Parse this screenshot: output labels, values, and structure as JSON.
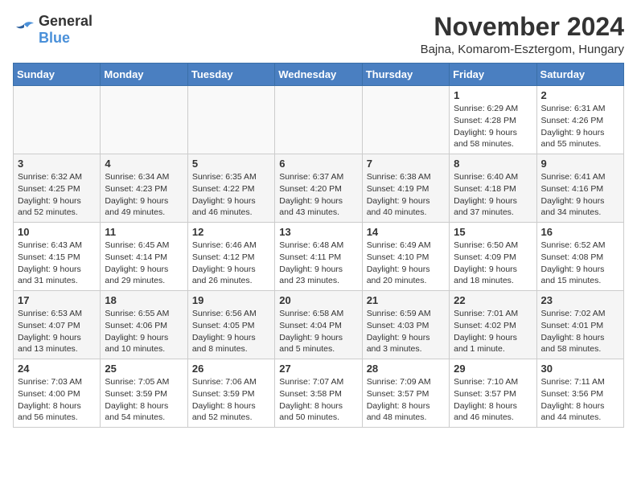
{
  "logo": {
    "general": "General",
    "blue": "Blue"
  },
  "title": "November 2024",
  "location": "Bajna, Komarom-Esztergom, Hungary",
  "days_of_week": [
    "Sunday",
    "Monday",
    "Tuesday",
    "Wednesday",
    "Thursday",
    "Friday",
    "Saturday"
  ],
  "weeks": [
    [
      {
        "day": "",
        "info": ""
      },
      {
        "day": "",
        "info": ""
      },
      {
        "day": "",
        "info": ""
      },
      {
        "day": "",
        "info": ""
      },
      {
        "day": "",
        "info": ""
      },
      {
        "day": "1",
        "info": "Sunrise: 6:29 AM\nSunset: 4:28 PM\nDaylight: 9 hours and 58 minutes."
      },
      {
        "day": "2",
        "info": "Sunrise: 6:31 AM\nSunset: 4:26 PM\nDaylight: 9 hours and 55 minutes."
      }
    ],
    [
      {
        "day": "3",
        "info": "Sunrise: 6:32 AM\nSunset: 4:25 PM\nDaylight: 9 hours and 52 minutes."
      },
      {
        "day": "4",
        "info": "Sunrise: 6:34 AM\nSunset: 4:23 PM\nDaylight: 9 hours and 49 minutes."
      },
      {
        "day": "5",
        "info": "Sunrise: 6:35 AM\nSunset: 4:22 PM\nDaylight: 9 hours and 46 minutes."
      },
      {
        "day": "6",
        "info": "Sunrise: 6:37 AM\nSunset: 4:20 PM\nDaylight: 9 hours and 43 minutes."
      },
      {
        "day": "7",
        "info": "Sunrise: 6:38 AM\nSunset: 4:19 PM\nDaylight: 9 hours and 40 minutes."
      },
      {
        "day": "8",
        "info": "Sunrise: 6:40 AM\nSunset: 4:18 PM\nDaylight: 9 hours and 37 minutes."
      },
      {
        "day": "9",
        "info": "Sunrise: 6:41 AM\nSunset: 4:16 PM\nDaylight: 9 hours and 34 minutes."
      }
    ],
    [
      {
        "day": "10",
        "info": "Sunrise: 6:43 AM\nSunset: 4:15 PM\nDaylight: 9 hours and 31 minutes."
      },
      {
        "day": "11",
        "info": "Sunrise: 6:45 AM\nSunset: 4:14 PM\nDaylight: 9 hours and 29 minutes."
      },
      {
        "day": "12",
        "info": "Sunrise: 6:46 AM\nSunset: 4:12 PM\nDaylight: 9 hours and 26 minutes."
      },
      {
        "day": "13",
        "info": "Sunrise: 6:48 AM\nSunset: 4:11 PM\nDaylight: 9 hours and 23 minutes."
      },
      {
        "day": "14",
        "info": "Sunrise: 6:49 AM\nSunset: 4:10 PM\nDaylight: 9 hours and 20 minutes."
      },
      {
        "day": "15",
        "info": "Sunrise: 6:50 AM\nSunset: 4:09 PM\nDaylight: 9 hours and 18 minutes."
      },
      {
        "day": "16",
        "info": "Sunrise: 6:52 AM\nSunset: 4:08 PM\nDaylight: 9 hours and 15 minutes."
      }
    ],
    [
      {
        "day": "17",
        "info": "Sunrise: 6:53 AM\nSunset: 4:07 PM\nDaylight: 9 hours and 13 minutes."
      },
      {
        "day": "18",
        "info": "Sunrise: 6:55 AM\nSunset: 4:06 PM\nDaylight: 9 hours and 10 minutes."
      },
      {
        "day": "19",
        "info": "Sunrise: 6:56 AM\nSunset: 4:05 PM\nDaylight: 9 hours and 8 minutes."
      },
      {
        "day": "20",
        "info": "Sunrise: 6:58 AM\nSunset: 4:04 PM\nDaylight: 9 hours and 5 minutes."
      },
      {
        "day": "21",
        "info": "Sunrise: 6:59 AM\nSunset: 4:03 PM\nDaylight: 9 hours and 3 minutes."
      },
      {
        "day": "22",
        "info": "Sunrise: 7:01 AM\nSunset: 4:02 PM\nDaylight: 9 hours and 1 minute."
      },
      {
        "day": "23",
        "info": "Sunrise: 7:02 AM\nSunset: 4:01 PM\nDaylight: 8 hours and 58 minutes."
      }
    ],
    [
      {
        "day": "24",
        "info": "Sunrise: 7:03 AM\nSunset: 4:00 PM\nDaylight: 8 hours and 56 minutes."
      },
      {
        "day": "25",
        "info": "Sunrise: 7:05 AM\nSunset: 3:59 PM\nDaylight: 8 hours and 54 minutes."
      },
      {
        "day": "26",
        "info": "Sunrise: 7:06 AM\nSunset: 3:59 PM\nDaylight: 8 hours and 52 minutes."
      },
      {
        "day": "27",
        "info": "Sunrise: 7:07 AM\nSunset: 3:58 PM\nDaylight: 8 hours and 50 minutes."
      },
      {
        "day": "28",
        "info": "Sunrise: 7:09 AM\nSunset: 3:57 PM\nDaylight: 8 hours and 48 minutes."
      },
      {
        "day": "29",
        "info": "Sunrise: 7:10 AM\nSunset: 3:57 PM\nDaylight: 8 hours and 46 minutes."
      },
      {
        "day": "30",
        "info": "Sunrise: 7:11 AM\nSunset: 3:56 PM\nDaylight: 8 hours and 44 minutes."
      }
    ]
  ]
}
